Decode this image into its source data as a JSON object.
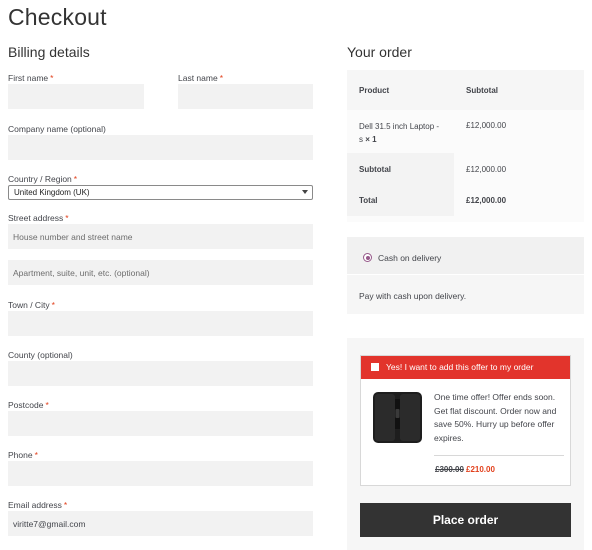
{
  "page_title": "Checkout",
  "billing": {
    "title": "Billing details",
    "required_marker": "*",
    "first_name": {
      "label": "First name",
      "value": ""
    },
    "last_name": {
      "label": "Last name",
      "value": ""
    },
    "company": {
      "label": "Company name (optional)",
      "value": ""
    },
    "country": {
      "label": "Country / Region",
      "value": "United Kingdom (UK)"
    },
    "street": {
      "label": "Street address",
      "placeholder1": "House number and street name",
      "placeholder2": "Apartment, suite, unit, etc. (optional)"
    },
    "town": {
      "label": "Town / City",
      "value": ""
    },
    "county": {
      "label": "County (optional)",
      "value": ""
    },
    "postcode": {
      "label": "Postcode",
      "value": ""
    },
    "phone": {
      "label": "Phone",
      "value": ""
    },
    "email": {
      "label": "Email address",
      "value": "viritte7@gmail.com"
    }
  },
  "order": {
    "title": "Your order",
    "col_product": "Product",
    "col_subtotal": "Subtotal",
    "item_name_line1": "Dell 31.5 inch Laptop -",
    "item_name_line2": "s",
    "item_qty": "× 1",
    "item_price": "£12,000.00",
    "subtotal_label": "Subtotal",
    "subtotal_value": "£12,000.00",
    "total_label": "Total",
    "total_value": "£12,000.00"
  },
  "payment": {
    "method_label": "Cash on delivery",
    "description": "Pay with cash upon delivery.",
    "accent_color": "#96588a"
  },
  "offer": {
    "header": "Yes! I want to add this offer to my order",
    "text": "One time offer! Offer ends soon. Get flat discount. Order now and save 50%. Hurry up before offer expires.",
    "price_old": "£300.00",
    "price_new": "£210.00",
    "header_color": "#e2342c"
  },
  "place_order_label": "Place order"
}
